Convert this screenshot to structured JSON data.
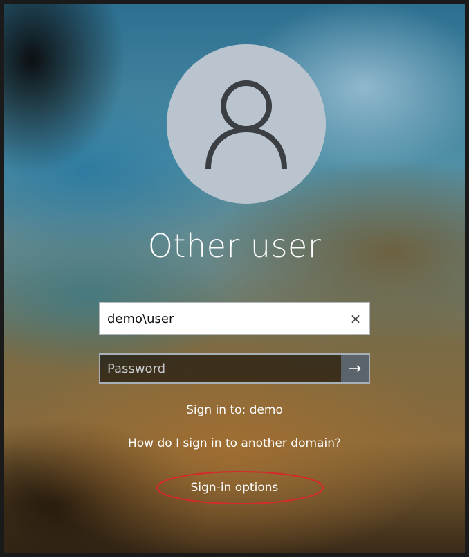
{
  "login": {
    "title": "Other user",
    "username_value": "demo\\user",
    "clear_glyph": "×",
    "password_placeholder": "Password",
    "submit_glyph": "→",
    "sign_in_to": "Sign in to: demo",
    "help_link": "How do I sign in to another domain?",
    "sign_in_options": "Sign-in options"
  },
  "icons": {
    "avatar": "user-silhouette-icon",
    "clear": "close-icon",
    "submit": "arrow-right-icon"
  },
  "colors": {
    "annotation_ellipse": "#d62a2a",
    "avatar_bg": "#b9c4cf",
    "avatar_glyph": "#3b3f44"
  }
}
